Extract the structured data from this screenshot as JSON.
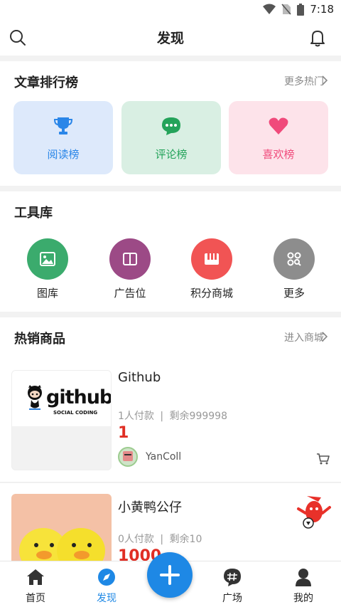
{
  "status_bar": {
    "time": "7:18"
  },
  "header": {
    "title": "发现"
  },
  "rank_section": {
    "title": "文章排行榜",
    "more": "更多热门",
    "cards": [
      {
        "label": "阅读榜",
        "bg": "#dde9fb",
        "color": "#2a86e8",
        "icon": "trophy-icon"
      },
      {
        "label": "评论榜",
        "bg": "#d9efe3",
        "color": "#24a35a",
        "icon": "comment-icon"
      },
      {
        "label": "喜欢榜",
        "bg": "#fde3ea",
        "color": "#f04a7b",
        "icon": "heart-icon"
      }
    ]
  },
  "tools_section": {
    "title": "工具库",
    "items": [
      {
        "label": "图库",
        "color": "#3bab6d",
        "icon": "image-icon"
      },
      {
        "label": "广告位",
        "color": "#9c4a86",
        "icon": "book-icon"
      },
      {
        "label": "积分商城",
        "color": "#f15454",
        "icon": "shop-icon"
      },
      {
        "label": "更多",
        "color": "#8d8d8d",
        "icon": "grid-search-icon"
      }
    ]
  },
  "hot_section": {
    "title": "热销商品",
    "more": "进入商城",
    "products": [
      {
        "name": "Github",
        "thumb_logo": "github",
        "thumb_tagline": "SOCIAL CODING",
        "paid": "1人付款",
        "separator": "|",
        "stock": "剩余999998",
        "price": "1",
        "seller": "YanColl"
      },
      {
        "name": "小黄鸭公仔",
        "paid": "0人付款",
        "separator": "|",
        "stock": "剩余10",
        "price": "1000"
      }
    ]
  },
  "tab_bar": {
    "tabs": [
      {
        "label": "首页",
        "icon": "home-icon"
      },
      {
        "label": "发现",
        "icon": "compass-icon",
        "active": true
      },
      {
        "label": "广场",
        "icon": "hashtag-icon"
      },
      {
        "label": "我的",
        "icon": "user-icon"
      }
    ],
    "active_color": "#1e88e5"
  }
}
